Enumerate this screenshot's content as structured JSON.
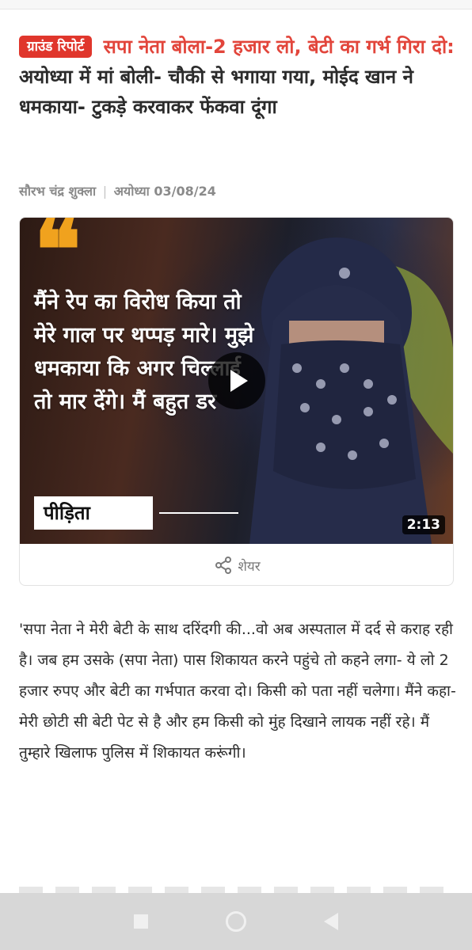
{
  "article": {
    "badge": "ग्राउंड रिपोर्ट",
    "headline_red": "सपा नेता बोला-2 हजार लो, बेटी का गर्भ गिरा दो:",
    "headline_rest": " अयोध्या में मां बोली- चौकी से भगाया गया, मोईद खान ने धमकाया- टुकड़े करवाकर फेंकवा दूंगा",
    "author": "सौरभ चंद्र शुक्ला",
    "location": "अयोध्या",
    "date": "03/08/24",
    "body": "'सपा नेता ने मेरी बेटी के साथ दरिंदगी की...वो अब अस्पताल में दर्द से कराह रही है। जब हम उसके (सपा नेता) पास शिकायत करने पहुंचे तो कहने लगा- ये लो 2 हजार रुपए और बेटी का गर्भपात करवा दो। किसी को पता नहीं चलेगा। मैंने कहा- मेरी छोटी सी बेटी पेट से है और हम किसी को मुंह दिखाने लायक नहीं रहे। मैं तुम्हारे खिलाफ पुलिस में शिकायत करूंगी।"
  },
  "video": {
    "quote_mark": "❝",
    "quote_text": "मैंने रेप का विरोध किया तो मेरे गाल पर थप्पड़ मारे। मुझे धमकाया कि अगर चिल्लाई तो मार देंगे। मैं बहुत डर",
    "speaker_label": "पीड़िता",
    "duration": "2:13",
    "share_label": "शेयर"
  },
  "colors": {
    "accent_red": "#e0362c",
    "quote_orange": "#f0a21e"
  },
  "icons": {
    "share": "share-icon",
    "play": "play-icon",
    "nav_recent": "square-icon",
    "nav_home": "circle-icon",
    "nav_back": "back-triangle-icon"
  }
}
